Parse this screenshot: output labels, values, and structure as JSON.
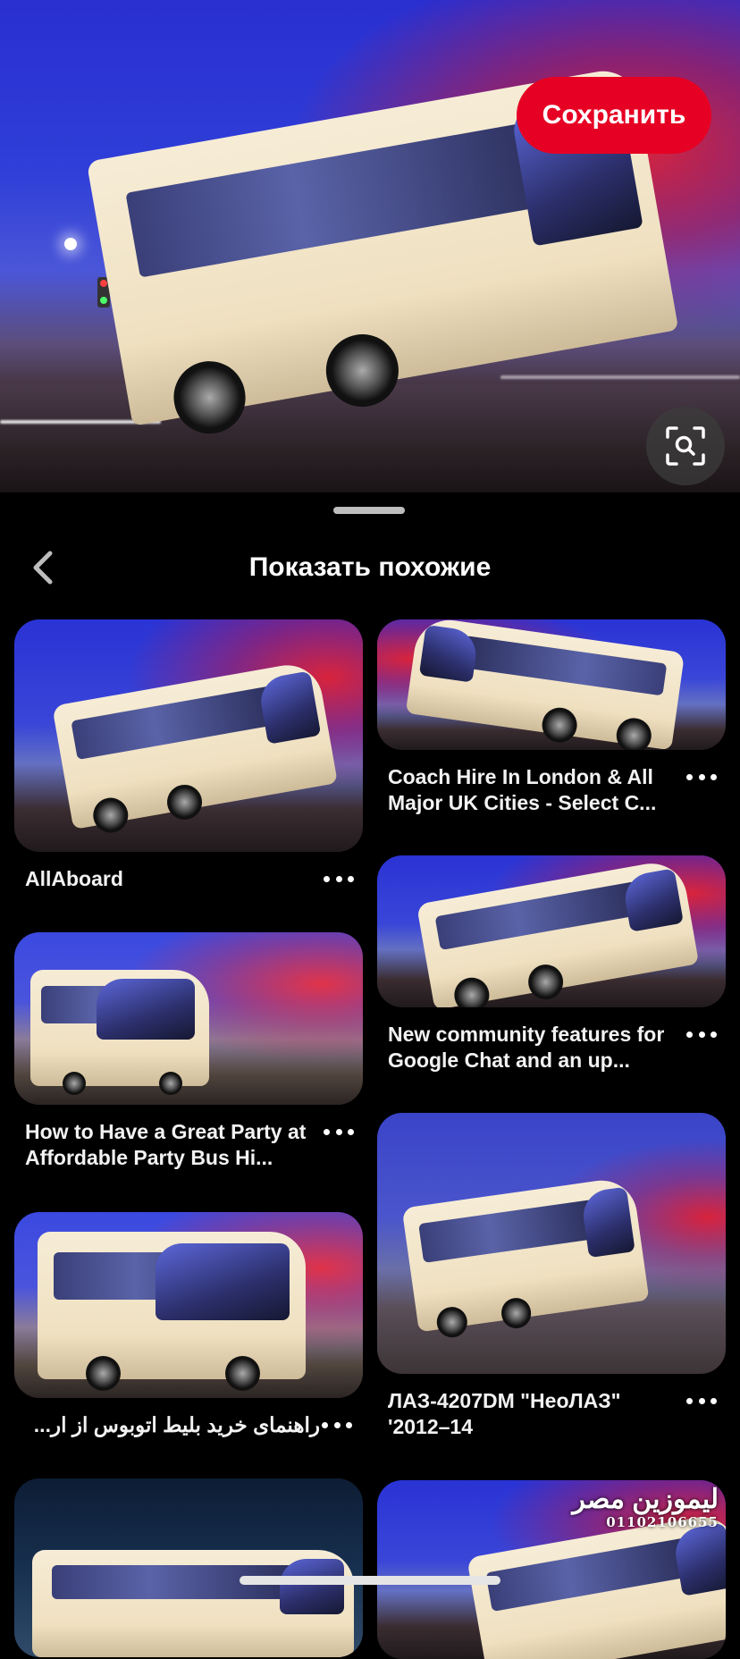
{
  "hero": {
    "save_label": "Сохранить",
    "visual_search_icon": "visual-search-icon"
  },
  "sheet": {
    "title": "Показать похожие",
    "back_icon": "chevron-left-icon"
  },
  "pins": {
    "left": [
      {
        "title": "AllAboard"
      },
      {
        "title": "How to Have a Great Party at Affordable Party Bus Hi..."
      },
      {
        "title": "راهنمای خرید بلیط اتوبوس از ار..."
      },
      {
        "title": ""
      }
    ],
    "right": [
      {
        "title": "Coach Hire In London & All Major UK Cities - Select C..."
      },
      {
        "title": "New community features for Google Chat and an up..."
      },
      {
        "title": "ЛАЗ-4207DM \"НеоЛАЗ\" '2012–14"
      },
      {
        "title": "",
        "watermark_name": "ليموزين مصر",
        "watermark_phone": "01102106655"
      }
    ]
  },
  "colors": {
    "accent": "#e60023",
    "background": "#000000",
    "text": "#ffffff"
  }
}
